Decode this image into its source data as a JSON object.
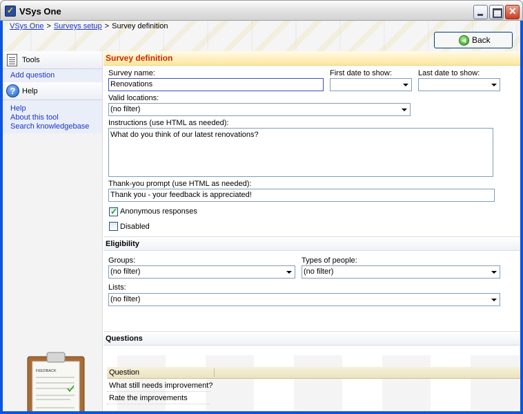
{
  "window": {
    "title": "VSys One"
  },
  "breadcrumb": {
    "items": [
      "VSys One",
      "Surveys setup"
    ],
    "separator": ">",
    "current": "Survey definition"
  },
  "toolbar": {
    "back_label": "Back"
  },
  "sidebar": {
    "tools_label": "Tools",
    "tools_items": [
      "Add question"
    ],
    "help_label": "Help",
    "help_items": [
      "Help",
      "About this tool",
      "Search knowledgebase"
    ],
    "clipboard_caption": "FEEDBACK"
  },
  "form": {
    "section_title": "Survey definition",
    "survey_name_label": "Survey name:",
    "survey_name_value": "Renovations",
    "first_date_label": "First date to show:",
    "first_date_value": "",
    "last_date_label": "Last date to show:",
    "last_date_value": "",
    "locations_label": "Valid locations:",
    "locations_value": "(no filter)",
    "instructions_label": "Instructions (use HTML as needed):",
    "instructions_value": "What do you think of our latest renovations?",
    "thankyou_label": "Thank-you prompt (use HTML as needed):",
    "thankyou_value": "Thank you - your feedback is appreciated!",
    "anonymous_label": "Anonymous responses",
    "anonymous_checked": true,
    "disabled_label": "Disabled",
    "disabled_checked": false
  },
  "eligibility": {
    "title": "Eligibility",
    "groups_label": "Groups:",
    "groups_value": "(no filter)",
    "types_label": "Types of people:",
    "types_value": "(no filter)",
    "lists_label": "Lists:",
    "lists_value": "(no filter)"
  },
  "questions": {
    "title": "Questions",
    "column_header": "Question",
    "rows": [
      "What still needs improvement?",
      "Rate the improvements"
    ]
  },
  "colors": {
    "title_accent": "#cc2a00",
    "link": "#1a35c8",
    "check": "#21a121"
  }
}
